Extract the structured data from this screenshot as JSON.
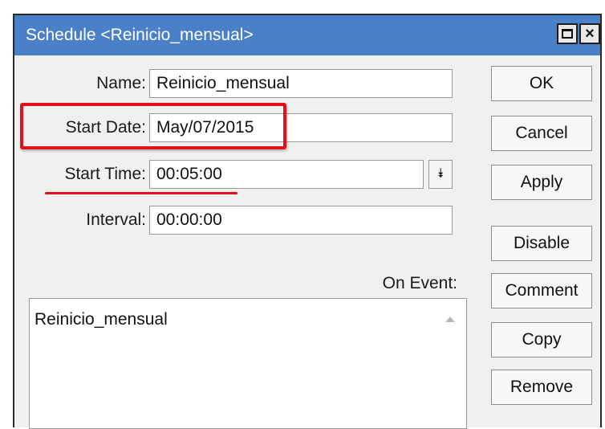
{
  "window": {
    "title": "Schedule <Reinicio_mensual>",
    "title_bar_color": "#4a80c8",
    "maximize_icon": "maximize-icon",
    "close_icon": "close-icon",
    "close_glyph": "×"
  },
  "form": {
    "name_label": "Name:",
    "name_value": "Reinicio_mensual",
    "start_date_label": "Start Date:",
    "start_date_value": "May/07/2015",
    "start_time_label": "Start Time:",
    "start_time_value": "00:05:00",
    "start_time_dropdown_glyph": "⯯",
    "interval_label": "Interval:",
    "interval_value": "00:00:00",
    "on_event_label": "On Event:",
    "on_event_value": "Reinicio_mensual"
  },
  "buttons": {
    "ok": "OK",
    "cancel": "Cancel",
    "apply": "Apply",
    "disable": "Disable",
    "comment": "Comment",
    "copy": "Copy",
    "remove": "Remove"
  },
  "annotations": {
    "highlight_color": "#e0121b"
  }
}
